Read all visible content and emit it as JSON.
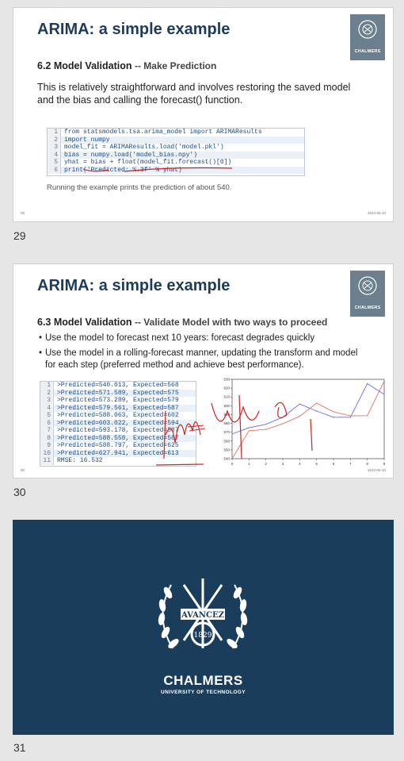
{
  "slides": [
    {
      "number": "29",
      "title": "ARIMA: a simple example",
      "logo_text": "CHALMERS",
      "subtitle_bold": "6.2 Model Validation",
      "subtitle_rest": "Make Prediction",
      "body": "This is relatively straightforward and involves restoring the saved model and the bias and calling the forecast() function.",
      "code_lines": [
        {
          "n": "1",
          "text": "from statsmodels.tsa.arima_model import ARIMAResults"
        },
        {
          "n": "2",
          "text": "import numpy"
        },
        {
          "n": "3",
          "text": "model_fit = ARIMAResults.load('model.pkl')"
        },
        {
          "n": "4",
          "text": "bias = numpy.load('model_bias.npy')"
        },
        {
          "n": "5",
          "text": "yhat = bias + float(model_fit.forecast()[0])"
        },
        {
          "n": "6",
          "text": "print('Predicted: %.3f' % yhat)"
        }
      ],
      "note": "Running the example prints the prediction of about 540.",
      "footer_left": "29",
      "footer_right": "2023-05-10"
    },
    {
      "number": "30",
      "title": "ARIMA: a simple example",
      "logo_text": "CHALMERS",
      "subtitle_bold": "6.3 Model Validation",
      "subtitle_rest": "Validate Model with two ways to proceed",
      "bullets": [
        "Use the model to forecast next 10 years: forecast degrades quickly",
        "Use the model in a rolling-forecast manner, updating the transform and model for each step (preferred method and achieve best performance)."
      ],
      "code_lines": [
        {
          "n": "1",
          "text": ">Predicted=540.013, Expected=568"
        },
        {
          "n": "2",
          "text": ">Predicted=571.589, Expected=575"
        },
        {
          "n": "3",
          "text": ">Predicted=573.289, Expected=579"
        },
        {
          "n": "4",
          "text": ">Predicted=579.561, Expected=587"
        },
        {
          "n": "5",
          "text": ">Predicted=588.063, Expected=602"
        },
        {
          "n": "6",
          "text": ">Predicted=603.022, Expected=594"
        },
        {
          "n": "7",
          "text": ">Predicted=593.178, Expected=587"
        },
        {
          "n": "8",
          "text": ">Predicted=588.558, Expected=587"
        },
        {
          "n": "9",
          "text": ">Predicted=588.797, Expected=625"
        },
        {
          "n": "10",
          "text": ">Predicted=627.941, Expected=613"
        },
        {
          "n": "11",
          "text": "RMSE: 16.532"
        }
      ],
      "footer_left": "30",
      "footer_right": "2023-05-10"
    },
    {
      "number": "31",
      "logo_word": "CHALMERS",
      "logo_sub": "UNIVERSITY OF TECHNOLOGY",
      "seal_motto": "AVANCEZ",
      "seal_year": "1829"
    }
  ],
  "chart_data": {
    "type": "line",
    "x": [
      0,
      1,
      2,
      3,
      4,
      5,
      6,
      7,
      8,
      9
    ],
    "ylim": [
      540,
      630
    ],
    "yticks": [
      540,
      550,
      560,
      570,
      580,
      590,
      600,
      610,
      620,
      630
    ],
    "series": [
      {
        "values": [
          568,
          575,
          579,
          587,
          602,
          594,
          587,
          587,
          625,
          613
        ],
        "color": "#6a6ae0"
      },
      {
        "values": [
          540.013,
          571.589,
          573.289,
          579.561,
          588.063,
          603.022,
          593.178,
          588.558,
          588.797,
          627.941
        ],
        "color": "#e07070"
      }
    ]
  }
}
